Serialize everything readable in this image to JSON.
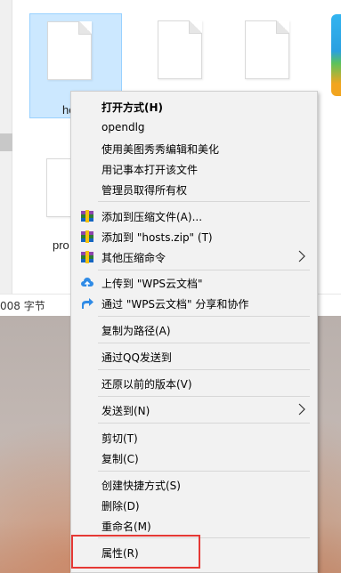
{
  "explorer": {
    "files": [
      {
        "name": "ho",
        "selected": true
      },
      {
        "name": "",
        "selected": false
      },
      {
        "name": "",
        "selected": false
      },
      {
        "name": "pro",
        "selected": false
      }
    ],
    "status_text": "008 字节"
  },
  "context_menu": {
    "items": [
      {
        "label": "打开方式(H)",
        "bold": true
      },
      {
        "label": "opendlg"
      },
      {
        "label": "使用美图秀秀编辑和美化"
      },
      {
        "label": "用记事本打开该文件"
      },
      {
        "label": "管理员取得所有权"
      },
      {
        "label": "添加到压缩文件(A)...",
        "icon": "archive-icon"
      },
      {
        "label": "添加到 \"hosts.zip\" (T)",
        "icon": "archive-icon"
      },
      {
        "label": "其他压缩命令",
        "icon": "archive-icon",
        "submenu": true
      },
      {
        "label": "上传到 \"WPS云文档\"",
        "icon": "cloud-upload-icon"
      },
      {
        "label": "通过 \"WPS云文档\" 分享和协作",
        "icon": "share-icon"
      },
      {
        "label": "复制为路径(A)"
      },
      {
        "label": "通过QQ发送到"
      },
      {
        "label": "还原以前的版本(V)"
      },
      {
        "label": "发送到(N)",
        "submenu": true
      },
      {
        "label": "剪切(T)"
      },
      {
        "label": "复制(C)"
      },
      {
        "label": "创建快捷方式(S)"
      },
      {
        "label": "删除(D)"
      },
      {
        "label": "重命名(M)"
      },
      {
        "label": "属性(R)"
      }
    ]
  },
  "colors": {
    "selection_fill": "#cce8ff",
    "highlight_border": "#e53935",
    "menu_bg": "#f2f2f2"
  }
}
